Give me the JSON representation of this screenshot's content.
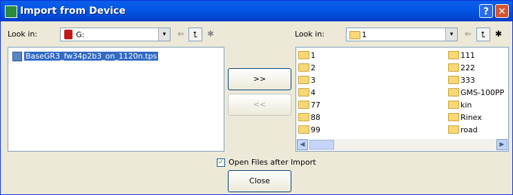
{
  "window": {
    "title": "Import from Device",
    "help_glyph": "?",
    "close_glyph": "✕"
  },
  "left": {
    "look_in_label": "Look in:",
    "drive_value": "G:",
    "files": [
      "BaseGR3_fw34p2b3_on_1120n.tps"
    ]
  },
  "right": {
    "look_in_label": "Look in:",
    "folder_value": "1",
    "folders_col1": [
      "1",
      "2",
      "3",
      "4",
      "77",
      "88",
      "99"
    ],
    "folders_col2": [
      "111",
      "222",
      "333",
      "GMS-100PP",
      "kin",
      "Rinex",
      "road"
    ]
  },
  "transfer": {
    "add_label": ">>",
    "remove_label": "<<"
  },
  "options": {
    "open_after_import_label": "Open Files after Import",
    "open_after_import_checked": true
  },
  "footer": {
    "close_label": "Close"
  },
  "icons": {
    "dropdown": "▾",
    "back": "⇐",
    "up": "⮤",
    "newfolder": "✱",
    "scroll_left": "◀",
    "scroll_right": "▶"
  }
}
